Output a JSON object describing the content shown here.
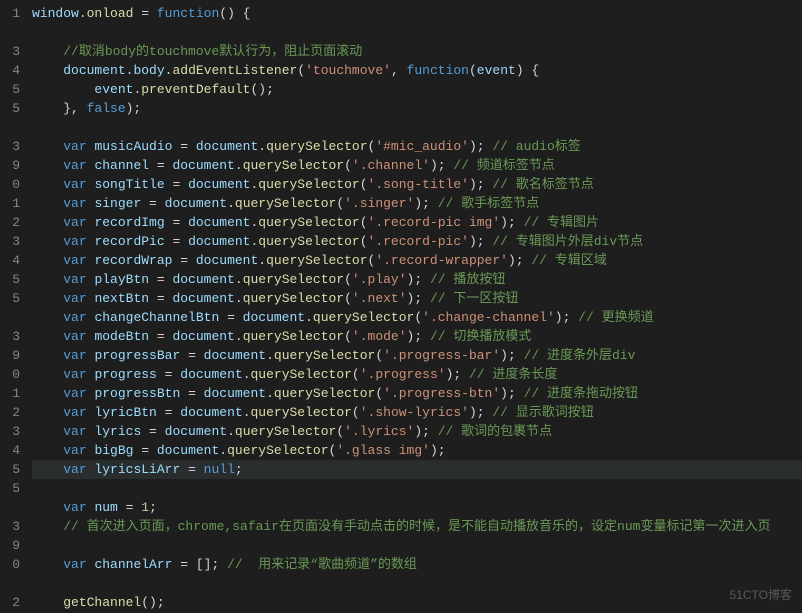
{
  "gutter": [
    "1",
    "",
    "3",
    "4",
    "5",
    "5",
    "",
    "3",
    "9",
    "0",
    "1",
    "2",
    "3",
    "4",
    "5",
    "5",
    "",
    "3",
    "9",
    "0",
    "1",
    "2",
    "3",
    "4",
    "5",
    "5",
    "",
    "3",
    "9",
    "0",
    "",
    "2"
  ],
  "watermark": "51CTO博客",
  "lines": [
    {
      "t": [
        [
          "id",
          "window"
        ],
        [
          "p",
          "."
        ],
        [
          "fn",
          "onload"
        ],
        [
          "p",
          " = "
        ],
        [
          "k",
          "function"
        ],
        [
          "p",
          "() {"
        ]
      ]
    },
    {
      "t": []
    },
    {
      "t": [
        [
          "p",
          "    "
        ],
        [
          "c",
          "//取消body的touchmove默认行为，阻止页面滚动"
        ]
      ]
    },
    {
      "t": [
        [
          "p",
          "    "
        ],
        [
          "id",
          "document"
        ],
        [
          "p",
          "."
        ],
        [
          "id",
          "body"
        ],
        [
          "p",
          "."
        ],
        [
          "fn",
          "addEventListener"
        ],
        [
          "p",
          "("
        ],
        [
          "s",
          "'touchmove'"
        ],
        [
          "p",
          ", "
        ],
        [
          "k",
          "function"
        ],
        [
          "p",
          "("
        ],
        [
          "id",
          "event"
        ],
        [
          "p",
          ") {"
        ]
      ]
    },
    {
      "t": [
        [
          "p",
          "        "
        ],
        [
          "id",
          "event"
        ],
        [
          "p",
          "."
        ],
        [
          "fn",
          "preventDefault"
        ],
        [
          "p",
          "();"
        ]
      ]
    },
    {
      "t": [
        [
          "p",
          "    }, "
        ],
        [
          "k",
          "false"
        ],
        [
          "p",
          ");"
        ]
      ]
    },
    {
      "t": []
    },
    {
      "t": [
        [
          "p",
          "    "
        ],
        [
          "k",
          "var"
        ],
        [
          "p",
          " "
        ],
        [
          "id",
          "musicAudio"
        ],
        [
          "p",
          " = "
        ],
        [
          "id",
          "document"
        ],
        [
          "p",
          "."
        ],
        [
          "fn",
          "querySelector"
        ],
        [
          "p",
          "("
        ],
        [
          "s",
          "'#mic_audio'"
        ],
        [
          "p",
          "); "
        ],
        [
          "c",
          "// audio标签"
        ]
      ]
    },
    {
      "t": [
        [
          "p",
          "    "
        ],
        [
          "k",
          "var"
        ],
        [
          "p",
          " "
        ],
        [
          "id",
          "channel"
        ],
        [
          "p",
          " = "
        ],
        [
          "id",
          "document"
        ],
        [
          "p",
          "."
        ],
        [
          "fn",
          "querySelector"
        ],
        [
          "p",
          "("
        ],
        [
          "s",
          "'.channel'"
        ],
        [
          "p",
          "); "
        ],
        [
          "c",
          "// 频道标签节点"
        ]
      ]
    },
    {
      "t": [
        [
          "p",
          "    "
        ],
        [
          "k",
          "var"
        ],
        [
          "p",
          " "
        ],
        [
          "id",
          "songTitle"
        ],
        [
          "p",
          " = "
        ],
        [
          "id",
          "document"
        ],
        [
          "p",
          "."
        ],
        [
          "fn",
          "querySelector"
        ],
        [
          "p",
          "("
        ],
        [
          "s",
          "'.song-title'"
        ],
        [
          "p",
          "); "
        ],
        [
          "c",
          "// 歌名标签节点"
        ]
      ]
    },
    {
      "t": [
        [
          "p",
          "    "
        ],
        [
          "k",
          "var"
        ],
        [
          "p",
          " "
        ],
        [
          "id",
          "singer"
        ],
        [
          "p",
          " = "
        ],
        [
          "id",
          "document"
        ],
        [
          "p",
          "."
        ],
        [
          "fn",
          "querySelector"
        ],
        [
          "p",
          "("
        ],
        [
          "s",
          "'.singer'"
        ],
        [
          "p",
          "); "
        ],
        [
          "c",
          "// 歌手标签节点"
        ]
      ]
    },
    {
      "t": [
        [
          "p",
          "    "
        ],
        [
          "k",
          "var"
        ],
        [
          "p",
          " "
        ],
        [
          "id",
          "recordImg"
        ],
        [
          "p",
          " = "
        ],
        [
          "id",
          "document"
        ],
        [
          "p",
          "."
        ],
        [
          "fn",
          "querySelector"
        ],
        [
          "p",
          "("
        ],
        [
          "s",
          "'.record-pic img'"
        ],
        [
          "p",
          "); "
        ],
        [
          "c",
          "// 专辑图片"
        ]
      ]
    },
    {
      "t": [
        [
          "p",
          "    "
        ],
        [
          "k",
          "var"
        ],
        [
          "p",
          " "
        ],
        [
          "id",
          "recordPic"
        ],
        [
          "p",
          " = "
        ],
        [
          "id",
          "document"
        ],
        [
          "p",
          "."
        ],
        [
          "fn",
          "querySelector"
        ],
        [
          "p",
          "("
        ],
        [
          "s",
          "'.record-pic'"
        ],
        [
          "p",
          "); "
        ],
        [
          "c",
          "// 专辑图片外层div节点"
        ]
      ]
    },
    {
      "t": [
        [
          "p",
          "    "
        ],
        [
          "k",
          "var"
        ],
        [
          "p",
          " "
        ],
        [
          "id",
          "recordWrap"
        ],
        [
          "p",
          " = "
        ],
        [
          "id",
          "document"
        ],
        [
          "p",
          "."
        ],
        [
          "fn",
          "querySelector"
        ],
        [
          "p",
          "("
        ],
        [
          "s",
          "'.record-wrapper'"
        ],
        [
          "p",
          "); "
        ],
        [
          "c",
          "// 专辑区域"
        ]
      ]
    },
    {
      "t": [
        [
          "p",
          "    "
        ],
        [
          "k",
          "var"
        ],
        [
          "p",
          " "
        ],
        [
          "id",
          "playBtn"
        ],
        [
          "p",
          " = "
        ],
        [
          "id",
          "document"
        ],
        [
          "p",
          "."
        ],
        [
          "fn",
          "querySelector"
        ],
        [
          "p",
          "("
        ],
        [
          "s",
          "'.play'"
        ],
        [
          "p",
          "); "
        ],
        [
          "c",
          "// 播放按钮"
        ]
      ]
    },
    {
      "t": [
        [
          "p",
          "    "
        ],
        [
          "k",
          "var"
        ],
        [
          "p",
          " "
        ],
        [
          "id",
          "nextBtn"
        ],
        [
          "p",
          " = "
        ],
        [
          "id",
          "document"
        ],
        [
          "p",
          "."
        ],
        [
          "fn",
          "querySelector"
        ],
        [
          "p",
          "("
        ],
        [
          "s",
          "'.next'"
        ],
        [
          "p",
          "); "
        ],
        [
          "c",
          "// 下一区按钮"
        ]
      ]
    },
    {
      "t": [
        [
          "p",
          "    "
        ],
        [
          "k",
          "var"
        ],
        [
          "p",
          " "
        ],
        [
          "id",
          "changeChannelBtn"
        ],
        [
          "p",
          " = "
        ],
        [
          "id",
          "document"
        ],
        [
          "p",
          "."
        ],
        [
          "fn",
          "querySelector"
        ],
        [
          "p",
          "("
        ],
        [
          "s",
          "'.change-channel'"
        ],
        [
          "p",
          "); "
        ],
        [
          "c",
          "// 更换频道"
        ]
      ]
    },
    {
      "t": [
        [
          "p",
          "    "
        ],
        [
          "k",
          "var"
        ],
        [
          "p",
          " "
        ],
        [
          "id",
          "modeBtn"
        ],
        [
          "p",
          " = "
        ],
        [
          "id",
          "document"
        ],
        [
          "p",
          "."
        ],
        [
          "fn",
          "querySelector"
        ],
        [
          "p",
          "("
        ],
        [
          "s",
          "'.mode'"
        ],
        [
          "p",
          "); "
        ],
        [
          "c",
          "// 切换播放模式"
        ]
      ]
    },
    {
      "t": [
        [
          "p",
          "    "
        ],
        [
          "k",
          "var"
        ],
        [
          "p",
          " "
        ],
        [
          "id",
          "progressBar"
        ],
        [
          "p",
          " = "
        ],
        [
          "id",
          "document"
        ],
        [
          "p",
          "."
        ],
        [
          "fn",
          "querySelector"
        ],
        [
          "p",
          "("
        ],
        [
          "s",
          "'.progress-bar'"
        ],
        [
          "p",
          "); "
        ],
        [
          "c",
          "// 进度条外层div"
        ]
      ]
    },
    {
      "t": [
        [
          "p",
          "    "
        ],
        [
          "k",
          "var"
        ],
        [
          "p",
          " "
        ],
        [
          "id",
          "progress"
        ],
        [
          "p",
          " = "
        ],
        [
          "id",
          "document"
        ],
        [
          "p",
          "."
        ],
        [
          "fn",
          "querySelector"
        ],
        [
          "p",
          "("
        ],
        [
          "s",
          "'.progress'"
        ],
        [
          "p",
          "); "
        ],
        [
          "c",
          "// 进度条长度"
        ]
      ]
    },
    {
      "t": [
        [
          "p",
          "    "
        ],
        [
          "k",
          "var"
        ],
        [
          "p",
          " "
        ],
        [
          "id",
          "progressBtn"
        ],
        [
          "p",
          " = "
        ],
        [
          "id",
          "document"
        ],
        [
          "p",
          "."
        ],
        [
          "fn",
          "querySelector"
        ],
        [
          "p",
          "("
        ],
        [
          "s",
          "'.progress-btn'"
        ],
        [
          "p",
          "); "
        ],
        [
          "c",
          "// 进度条拖动按钮"
        ]
      ]
    },
    {
      "t": [
        [
          "p",
          "    "
        ],
        [
          "k",
          "var"
        ],
        [
          "p",
          " "
        ],
        [
          "id",
          "lyricBtn"
        ],
        [
          "p",
          " = "
        ],
        [
          "id",
          "document"
        ],
        [
          "p",
          "."
        ],
        [
          "fn",
          "querySelector"
        ],
        [
          "p",
          "("
        ],
        [
          "s",
          "'.show-lyrics'"
        ],
        [
          "p",
          "); "
        ],
        [
          "c",
          "// 显示歌词按钮"
        ]
      ]
    },
    {
      "t": [
        [
          "p",
          "    "
        ],
        [
          "k",
          "var"
        ],
        [
          "p",
          " "
        ],
        [
          "id",
          "lyrics"
        ],
        [
          "p",
          " = "
        ],
        [
          "id",
          "document"
        ],
        [
          "p",
          "."
        ],
        [
          "fn",
          "querySelector"
        ],
        [
          "p",
          "("
        ],
        [
          "s",
          "'.lyrics'"
        ],
        [
          "p",
          "); "
        ],
        [
          "c",
          "// 歌词的包裹节点"
        ]
      ]
    },
    {
      "t": [
        [
          "p",
          "    "
        ],
        [
          "k",
          "var"
        ],
        [
          "p",
          " "
        ],
        [
          "id",
          "bigBg"
        ],
        [
          "p",
          " = "
        ],
        [
          "id",
          "document"
        ],
        [
          "p",
          "."
        ],
        [
          "fn",
          "querySelector"
        ],
        [
          "p",
          "("
        ],
        [
          "s",
          "'.glass img'"
        ],
        [
          "p",
          ");"
        ]
      ]
    },
    {
      "hl": true,
      "t": [
        [
          "p",
          "    "
        ],
        [
          "k",
          "var"
        ],
        [
          "p",
          " "
        ],
        [
          "id",
          "lyricsLiArr"
        ],
        [
          "p",
          " = "
        ],
        [
          "bf",
          "null"
        ],
        [
          "p",
          ";"
        ]
      ]
    },
    {
      "t": []
    },
    {
      "t": [
        [
          "p",
          "    "
        ],
        [
          "k",
          "var"
        ],
        [
          "p",
          " "
        ],
        [
          "id",
          "num"
        ],
        [
          "p",
          " = "
        ],
        [
          "n",
          "1"
        ],
        [
          "p",
          ";"
        ]
      ]
    },
    {
      "t": [
        [
          "p",
          "    "
        ],
        [
          "c",
          "// 首次进入页面，chrome,safair在页面没有手动点击的时候，是不能自动播放音乐的，设定num变量标记第一次进入页"
        ]
      ]
    },
    {
      "t": []
    },
    {
      "t": [
        [
          "p",
          "    "
        ],
        [
          "k",
          "var"
        ],
        [
          "p",
          " "
        ],
        [
          "id",
          "channelArr"
        ],
        [
          "p",
          " = []; "
        ],
        [
          "c",
          "//  用来记录“歌曲频道”的数组"
        ]
      ]
    },
    {
      "t": []
    },
    {
      "t": [
        [
          "p",
          "    "
        ],
        [
          "fn",
          "getChannel"
        ],
        [
          "p",
          "();"
        ]
      ]
    }
  ]
}
